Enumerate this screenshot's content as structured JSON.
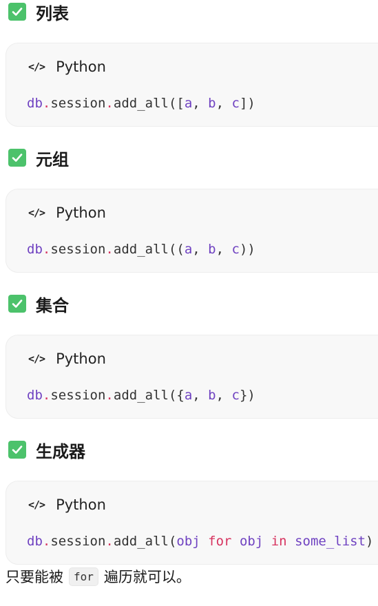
{
  "sections": [
    {
      "heading": "列表",
      "lang": "Python",
      "code": {
        "mod": "db",
        "dot": ".",
        "plain1": "session",
        "dot2": ".",
        "fn": "add_all([",
        "a": "a",
        "sep1": ", ",
        "b": "b",
        "sep2": ", ",
        "c": "c",
        "close": "])"
      }
    },
    {
      "heading": "元组",
      "lang": "Python",
      "code": {
        "mod": "db",
        "dot": ".",
        "plain1": "session",
        "dot2": ".",
        "fn": "add_all((",
        "a": "a",
        "sep1": ", ",
        "b": "b",
        "sep2": ", ",
        "c": "c",
        "close": "))"
      }
    },
    {
      "heading": "集合",
      "lang": "Python",
      "code": {
        "mod": "db",
        "dot": ".",
        "plain1": "session",
        "dot2": ".",
        "fn": "add_all({",
        "a": "a",
        "sep1": ", ",
        "b": "b",
        "sep2": ", ",
        "c": "c",
        "close": "})"
      }
    },
    {
      "heading": "生成器",
      "lang": "Python",
      "code": {
        "mod": "db",
        "dot": ".",
        "plain1": "session",
        "dot2": ".",
        "fn": "add_all(",
        "obj1": "obj",
        "kw1": "for",
        "obj2": "obj",
        "kw2": "in",
        "var": "some_list",
        "close": ")"
      }
    }
  ],
  "footer": {
    "before": "只要能被",
    "code": "for",
    "after": "遍历就可以。"
  },
  "colors": {
    "check": "#4cc26b",
    "module": "#6f42c1",
    "keyword": "#d7335f"
  },
  "icons": {
    "check": "check-mark-icon",
    "code": "code-icon"
  }
}
